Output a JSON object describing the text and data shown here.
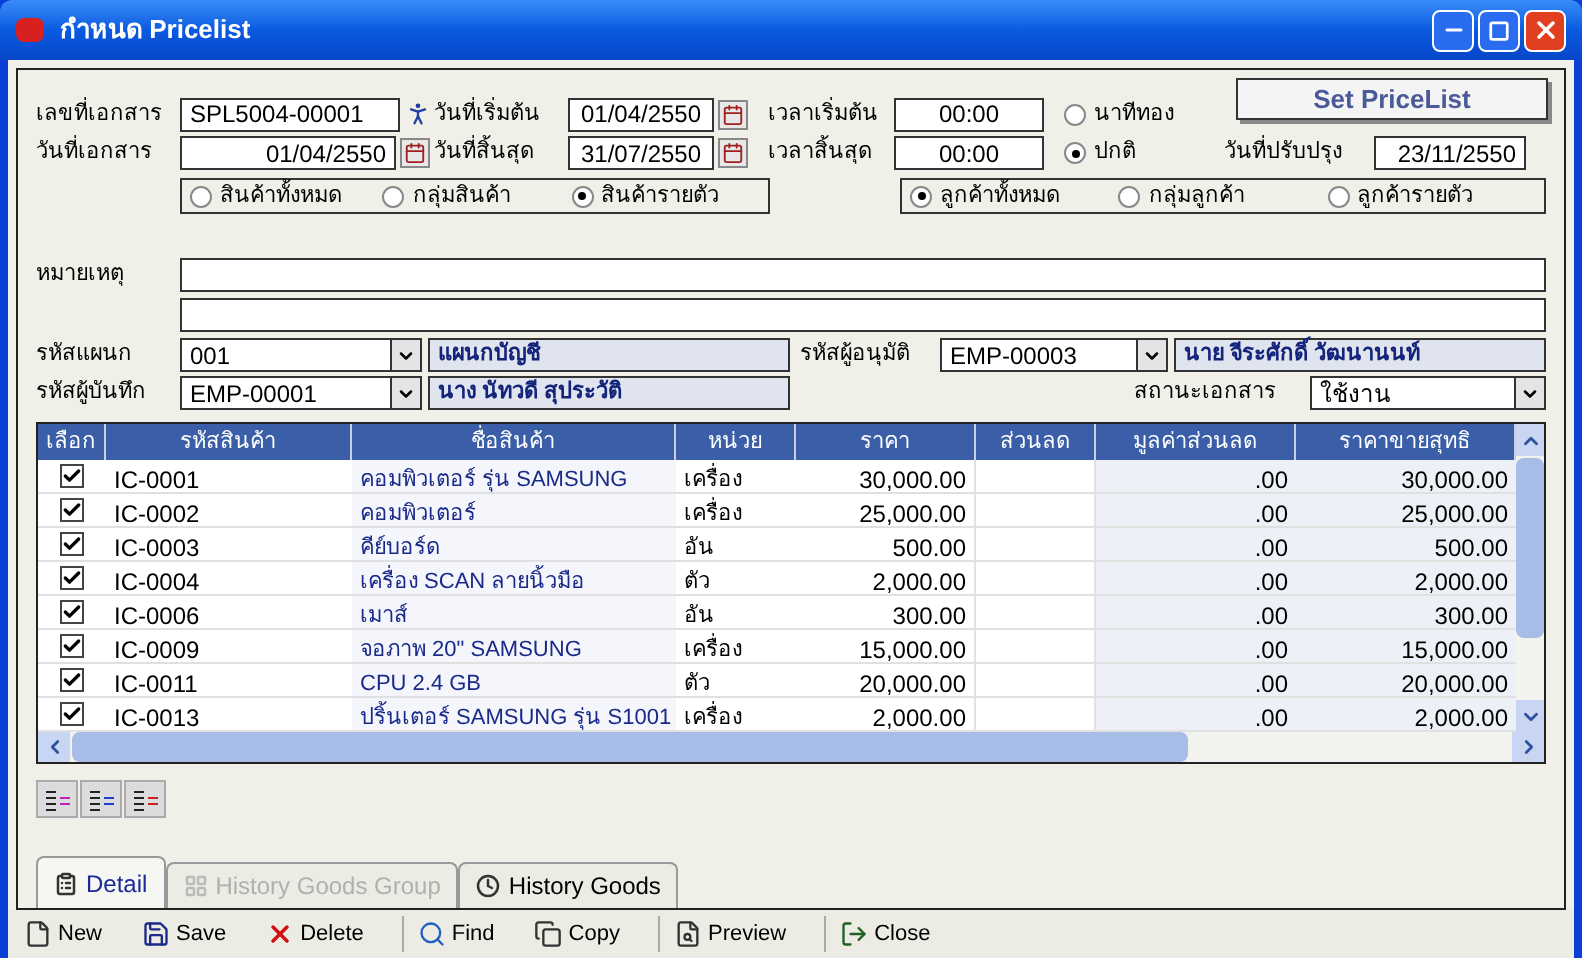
{
  "window": {
    "title": "กำหนด Pricelist"
  },
  "header": {
    "doc_no_label": "เลขที่เอกสาร",
    "doc_no": "SPL5004-00001",
    "doc_date_label": "วันที่เอกสาร",
    "doc_date": "01/04/2550",
    "start_date_label": "วันที่เริ่มต้น",
    "start_date": "01/04/2550",
    "end_date_label": "วันที่สิ้นสุด",
    "end_date": "31/07/2550",
    "start_time_label": "เวลาเริ่มต้น",
    "start_time": "00:00",
    "end_time_label": "เวลาสิ้นสุด",
    "end_time": "00:00",
    "set_button": "Set PriceList",
    "updated_label": "วันที่ปรับปรุง",
    "updated": "23/11/2550"
  },
  "time_mode": [
    {
      "label": "นาทีทอง",
      "selected": false
    },
    {
      "label": "ปกติ",
      "selected": true
    }
  ],
  "product_scope": [
    {
      "label": "สินค้าทั้งหมด",
      "selected": false
    },
    {
      "label": "กลุ่มสินค้า",
      "selected": false
    },
    {
      "label": "สินค้ารายตัว",
      "selected": true
    }
  ],
  "customer_scope": [
    {
      "label": "ลูกค้าทั้งหมด",
      "selected": true
    },
    {
      "label": "กลุ่มลูกค้า",
      "selected": false
    },
    {
      "label": "ลูกค้ารายตัว",
      "selected": false
    }
  ],
  "note_label": "หมายเหตุ",
  "department": {
    "label": "รหัสแผนก",
    "code": "001",
    "name": "แผนกบัญชี"
  },
  "approver": {
    "label": "รหัสผู้อนุมัติ",
    "code": "EMP-00003",
    "name": "นาย จีระศักดิ์ วัฒนานนท์"
  },
  "recorder": {
    "label": "รหัสผู้บันทึก",
    "code": "EMP-00001",
    "name": "นาง นัทวดี สุประวัติ"
  },
  "status": {
    "label": "สถานะเอกสาร",
    "value": "ใช้งาน"
  },
  "table": {
    "columns": [
      "เลือก",
      "รหัสสินค้า",
      "ชื่อสินค้า",
      "หน่วย",
      "ราคา",
      "ส่วนลด",
      "มูลค่าส่วนลด",
      "ราคาขายสุทธิ"
    ],
    "rows": [
      {
        "checked": true,
        "code": "IC-0001",
        "name": "คอมพิวเตอร์ รุ่น SAMSUNG",
        "unit": "เครื่อง",
        "price": "30,000.00",
        "discount_value": ".00",
        "net": "30,000.00"
      },
      {
        "checked": true,
        "code": "IC-0002",
        "name": "คอมพิวเตอร์",
        "unit": "เครื่อง",
        "price": "25,000.00",
        "discount_value": ".00",
        "net": "25,000.00"
      },
      {
        "checked": true,
        "code": "IC-0003",
        "name": "คีย์บอร์ด",
        "unit": "อัน",
        "price": "500.00",
        "discount_value": ".00",
        "net": "500.00"
      },
      {
        "checked": true,
        "code": "IC-0004",
        "name": "เครื่อง SCAN ลายนิ้วมือ",
        "unit": "ตัว",
        "price": "2,000.00",
        "discount_value": ".00",
        "net": "2,000.00"
      },
      {
        "checked": true,
        "code": "IC-0006",
        "name": "เมาส์",
        "unit": "อัน",
        "price": "300.00",
        "discount_value": ".00",
        "net": "300.00"
      },
      {
        "checked": true,
        "code": "IC-0009",
        "name": "จอภาพ 20\" SAMSUNG",
        "unit": "เครื่อง",
        "price": "15,000.00",
        "discount_value": ".00",
        "net": "15,000.00"
      },
      {
        "checked": true,
        "code": "IC-0011",
        "name": "CPU  2.4 GB",
        "unit": "ตัว",
        "price": "20,000.00",
        "discount_value": ".00",
        "net": "20,000.00"
      },
      {
        "checked": true,
        "code": "IC-0013",
        "name": "ปริ้นเตอร์ SAMSUNG  รุ่น S1001",
        "unit": "เครื่อง",
        "price": "2,000.00",
        "discount_value": ".00",
        "net": "2,000.00"
      }
    ]
  },
  "tabs": [
    {
      "label": "Detail",
      "selected": true,
      "disabled": false
    },
    {
      "label": "History Goods Group",
      "selected": false,
      "disabled": true
    },
    {
      "label": "History Goods",
      "selected": false,
      "disabled": false
    }
  ],
  "toolbar": [
    {
      "kind": "new",
      "label": "New"
    },
    {
      "kind": "save",
      "label": "Save"
    },
    {
      "kind": "delete",
      "label": "Delete"
    },
    {
      "kind": "find",
      "label": "Find"
    },
    {
      "kind": "copy",
      "label": "Copy"
    },
    {
      "kind": "preview",
      "label": "Preview"
    },
    {
      "kind": "close",
      "label": "Close"
    }
  ]
}
